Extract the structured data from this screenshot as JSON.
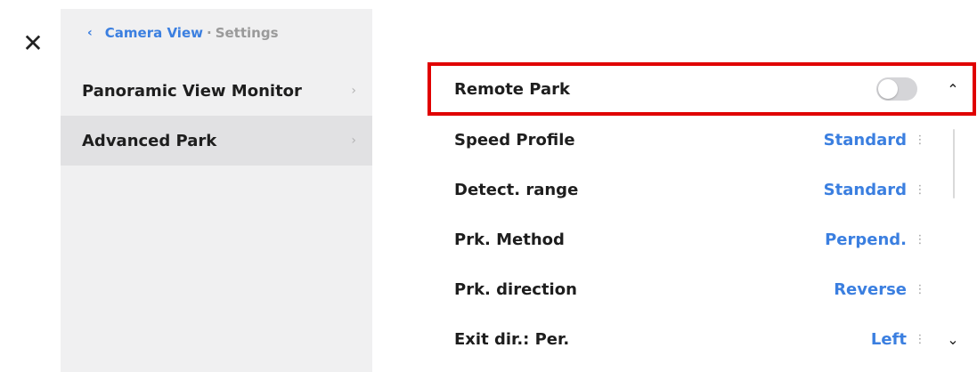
{
  "close": {
    "icon": "close-icon",
    "glyph": "✕"
  },
  "breadcrumb": {
    "back_glyph": "‹",
    "parent": "Camera View",
    "separator": "·",
    "current": "Settings"
  },
  "sidebar": {
    "items": [
      {
        "label": "Panoramic View Monitor",
        "chevron": "›",
        "active": false
      },
      {
        "label": "Advanced Park",
        "chevron": "›",
        "active": true
      }
    ]
  },
  "header_row": {
    "label": "Remote Park",
    "toggle_on": false,
    "collapse_glyph": "⌃"
  },
  "settings": [
    {
      "label": "Speed Profile",
      "value": "Standard",
      "dots": "⋮"
    },
    {
      "label": "Detect. range",
      "value": "Standard",
      "dots": "⋮"
    },
    {
      "label": "Prk. Method",
      "value": "Perpend.",
      "dots": "⋮"
    },
    {
      "label": "Prk. direction",
      "value": "Reverse",
      "dots": "⋮"
    },
    {
      "label": "Exit dir.: Per.",
      "value": "Left",
      "dots": "⋮",
      "expand_glyph": "⌄"
    }
  ],
  "colors": {
    "accent": "#3b7fe0",
    "highlight_border": "#e00000",
    "sidebar_bg": "#f0f0f1",
    "sidebar_active_bg": "#e1e1e3"
  }
}
